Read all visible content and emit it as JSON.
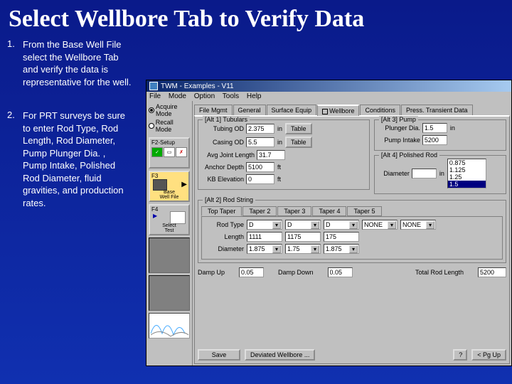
{
  "slide": {
    "title": "Select Wellbore Tab to Verify Data",
    "step1_num": "1.",
    "step1_text": "From the Base Well File select the Wellbore Tab and verify the data is representative for the well.",
    "step2_num": "2.",
    "step2_text": "For PRT surveys be sure to enter Rod Type, Rod Length, Rod Diameter, Pump Plunger Dia. , Pump Intake, Polished Rod Diameter, fluid gravities, and production rates."
  },
  "app": {
    "title": "TWM - Examples - V11",
    "menus": [
      "File",
      "Mode",
      "Option",
      "Tools",
      "Help"
    ],
    "radio_acquire": "Acquire Mode",
    "radio_recall": "Recall Mode",
    "f2": "F2-Setup",
    "f3": "F3",
    "f3_sub1": "Base",
    "f3_sub2": "Well File",
    "f4": "F4",
    "f4_sub1": "Select",
    "f4_sub2": "Test"
  },
  "tabs": {
    "filemgmt": "File Mgmt",
    "general": "General",
    "surface": "Surface Equip",
    "wellbore": "Wellbore",
    "conditions": "Conditions",
    "transient": "Press. Transient Data"
  },
  "wellbore": {
    "tubulars_legend": "[Alt 1] Tubulars",
    "tubing_od_lbl": "Tubing OD",
    "tubing_od": "2.375",
    "casing_od_lbl": "Casing OD",
    "casing_od": "5.5",
    "avg_joint_lbl": "Avg Joint Length",
    "avg_joint": "31.7",
    "anchor_lbl": "Anchor Depth",
    "anchor": "5100",
    "kb_lbl": "KB Elevation",
    "kb": "0",
    "table_btn": "Table",
    "unit_in": "in",
    "unit_ft": "ft"
  },
  "pump": {
    "legend": "[Alt 3] Pump",
    "plunger_lbl": "Plunger Dia.",
    "plunger": "1.5",
    "intake_lbl": "Pump Intake",
    "intake": "5200"
  },
  "rod": {
    "legend": "[Alt 4] Polished Rod",
    "dia_lbl": "Diameter",
    "dia": "",
    "options": [
      "0.875",
      "1.125",
      "1.25",
      "1.5"
    ],
    "sel_index": 3
  },
  "rodstring": {
    "legend": "[Alt 2] Rod String",
    "tabs": [
      "Top Taper",
      "Taper 2",
      "Taper 3",
      "Taper 4",
      "Taper 5"
    ],
    "type_lbl": "Rod Type",
    "type": "D",
    "length_lbl": "Length",
    "lengths": [
      "1111",
      "1175",
      "175"
    ],
    "dia_lbl": "Diameter",
    "dias": [
      "1.875",
      "1.75",
      "1.875"
    ],
    "none": "NONE"
  },
  "damp": {
    "up_lbl": "Damp Up",
    "up": "0.05",
    "down_lbl": "Damp Down",
    "down": "0.05",
    "tool_lbl": "Total Rod Length",
    "tool": "5200"
  },
  "buttons": {
    "save": "Save",
    "deviated": "Deviated Wellbore ...",
    "help": "?",
    "prev": "< Pg Up"
  }
}
